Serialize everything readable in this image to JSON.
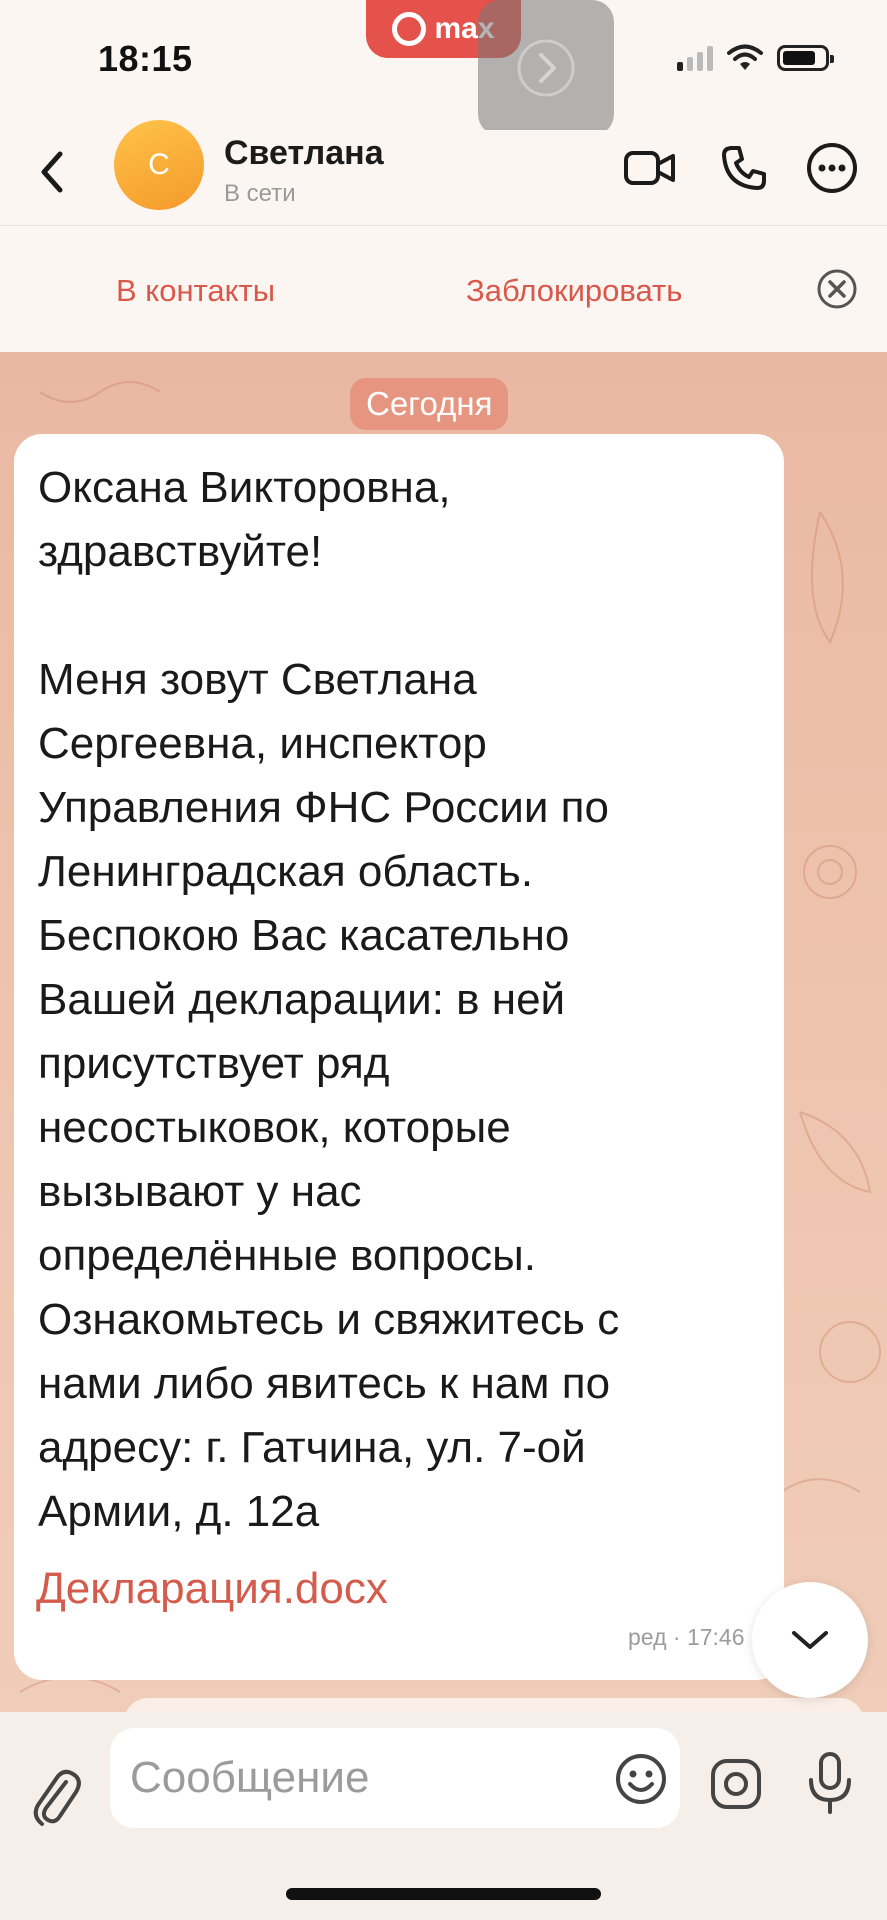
{
  "status_bar": {
    "time": "18:15",
    "max_badge": "max",
    "icons": [
      "signal-icon",
      "wifi-icon",
      "battery-icon"
    ]
  },
  "header": {
    "back_icon": "chevron-left-icon",
    "avatar_letter": "С",
    "contact_name": "Светлана",
    "contact_status": "В сети",
    "icons": [
      "video-call-icon",
      "phone-icon",
      "more-icon"
    ]
  },
  "action_bar": {
    "add_contact_label": "В контакты",
    "block_label": "Заблокировать",
    "close_icon": "close-circle-icon"
  },
  "chat": {
    "date_label": "Сегодня",
    "message": {
      "text": "Оксана Викторовна,\nздравствуйте!\n\nМеня зовут Светлана\nСергеевна, инспектор\nУправления ФНС России по\nЛенинградская область.\nБеспокою Вас касательно\nВашей декларации: в ней\nприсутствует ряд\nнесостыковок, которые\nвызывают у нас\nопределённые вопросы.\nОзнакомьтесь и свяжитесь с\nнами либо явитесь к нам по\nадресу: г. Гатчина, ул. 7-ой\nАрмии, д. 12а",
      "attachment": "Декларация.docx",
      "meta": "ред · 17:46"
    }
  },
  "composer": {
    "placeholder": "Сообщение"
  },
  "colors": {
    "accent": "#d9584b",
    "max_brand": "#e4524b",
    "avatar": "#f7a93a"
  }
}
